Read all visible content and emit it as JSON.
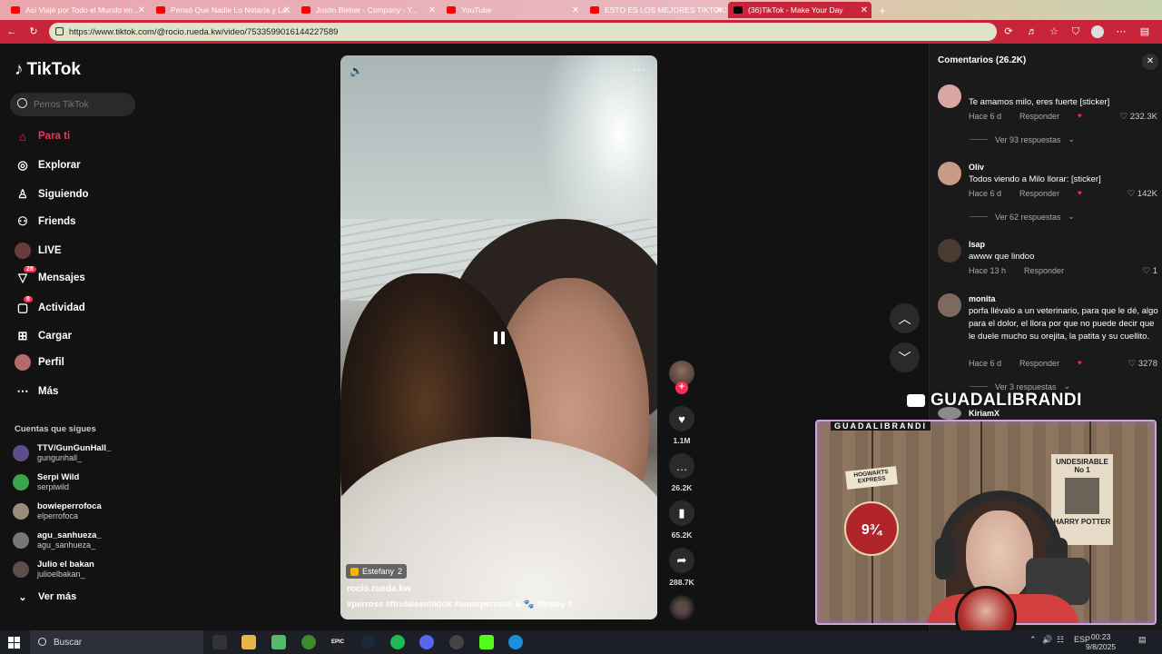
{
  "browser": {
    "tabs": [
      {
        "title": "Así Viajé por Todo el Mundo en..."
      },
      {
        "title": "Pensó Que Nadie Lo Notaría y La..."
      },
      {
        "title": "Justin Bieber - Company - Y..."
      },
      {
        "title": "YouTube"
      },
      {
        "title": "ESTO ES LOS MEJORES TIKTOKS"
      },
      {
        "title": "(36)TikTok - Make Your Day"
      }
    ],
    "new_tab": "+",
    "url": "https://www.tiktok.com/@rocio.rueda.kw/video/7533599016144227589"
  },
  "sidebar": {
    "logo": "TikTok",
    "search_placeholder": "Perros TikTok",
    "nav": [
      {
        "label": "Para ti",
        "icon": "home-icon"
      },
      {
        "label": "Explorar",
        "icon": "compass-icon"
      },
      {
        "label": "Siguiendo",
        "icon": "following-icon"
      },
      {
        "label": "Friends",
        "icon": "friends-icon"
      },
      {
        "label": "LIVE",
        "icon": "live-icon"
      },
      {
        "label": "Mensajes",
        "icon": "message-icon",
        "badge": "28"
      },
      {
        "label": "Actividad",
        "icon": "activity-icon",
        "badge": "8"
      },
      {
        "label": "Cargar",
        "icon": "upload-icon"
      },
      {
        "label": "Perfil",
        "icon": "profile-icon"
      },
      {
        "label": "Más",
        "icon": "more-icon"
      }
    ],
    "following_title": "Cuentas que sigues",
    "following": [
      {
        "name": "TTV/GunGunHall_",
        "handle": "gungunhall_"
      },
      {
        "name": "Serpi Wild",
        "handle": "serpiwild"
      },
      {
        "name": "bowieperrofoca",
        "handle": "elperrofoca"
      },
      {
        "name": "agu_sanhueza_",
        "handle": "agu_sanhueza_"
      },
      {
        "name": "Julio el bakan",
        "handle": "julioelbakan_"
      }
    ],
    "see_more": "Ver más"
  },
  "video": {
    "chip_label": "Estefany",
    "chip_count": "2",
    "author": "rocio.rueda.kw",
    "tags": "#perross  #firulaisentiktok  #amorperruno & 🐾  #frisby  #",
    "likes": "1.1M",
    "comments": "26.2K",
    "saves": "65.2K",
    "shares": "288.7K"
  },
  "comments": {
    "title": "Comentarios (26.2K)",
    "items": [
      {
        "user": "",
        "text": "Te amamos milo, eres fuerte [sticker]",
        "age": "Hace 6 d",
        "reply": "Responder",
        "likes": "232.3K",
        "replies": "Ver 93 respuestas"
      },
      {
        "user": "Oliv",
        "text": "Todos viendo a Milo llorar: [sticker]",
        "age": "Hace 6 d",
        "reply": "Responder",
        "likes": "142K",
        "replies": "Ver 62 respuestas"
      },
      {
        "user": "lsap",
        "text": "awww que lindoo",
        "age": "Hace 13 h",
        "reply": "Responder",
        "likes": "1"
      },
      {
        "user": "monita",
        "text": "porfa llévalo a un veterinario, para que le dé, algo para el dolor, el llora por que no puede decir que le duele mucho su orejita, la patita y su cuellito.",
        "age": "Hace 6 d",
        "reply": "Responder",
        "likes": "3278",
        "replies": "Ver 3 respuestas"
      },
      {
        "user": "KiriamX"
      }
    ]
  },
  "stream": {
    "channel": "GUADALIBRANDI",
    "cam_title": "GUADALIBRANDI",
    "hogwarts": "HOGWARTS EXPRESS",
    "platform": "9¾",
    "poster_title": "UNDESIRABLE",
    "poster_no": "No 1",
    "poster_name": "HARRY POTTER"
  },
  "taskbar": {
    "search": "Buscar",
    "lang": "ESP",
    "time": "00:23",
    "date": "9/8/2025"
  },
  "colors": {
    "tiktok_red": "#fe2c55",
    "browser_accent": "#c8243a"
  }
}
